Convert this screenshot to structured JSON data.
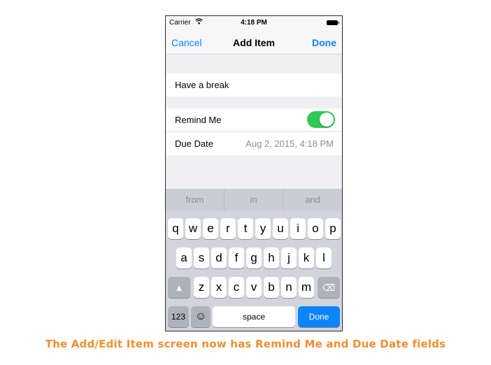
{
  "status_bar": {
    "carrier": "Carrier",
    "time": "4:18 PM"
  },
  "nav": {
    "cancel": "Cancel",
    "title": "Add Item",
    "done": "Done"
  },
  "form": {
    "text_value": "Have a break",
    "remind_label": "Remind Me",
    "remind_on": true,
    "due_label": "Due Date",
    "due_value": "Aug 2, 2015, 4:18 PM"
  },
  "keyboard": {
    "suggestions": [
      "from",
      "in",
      "and"
    ],
    "row1": [
      "q",
      "w",
      "e",
      "r",
      "t",
      "y",
      "u",
      "i",
      "o",
      "p"
    ],
    "row2": [
      "a",
      "s",
      "d",
      "f",
      "g",
      "h",
      "j",
      "k",
      "l"
    ],
    "row3": [
      "z",
      "x",
      "c",
      "v",
      "b",
      "n",
      "m"
    ],
    "numbers_key": "123",
    "space_key": "space",
    "done_key": "Done"
  },
  "caption": "The Add/Edit Item screen now has Remind Me and Due Date fields",
  "colors": {
    "accent": "#0a84ff",
    "toggle_on": "#34c759",
    "caption": "#f0902e"
  }
}
